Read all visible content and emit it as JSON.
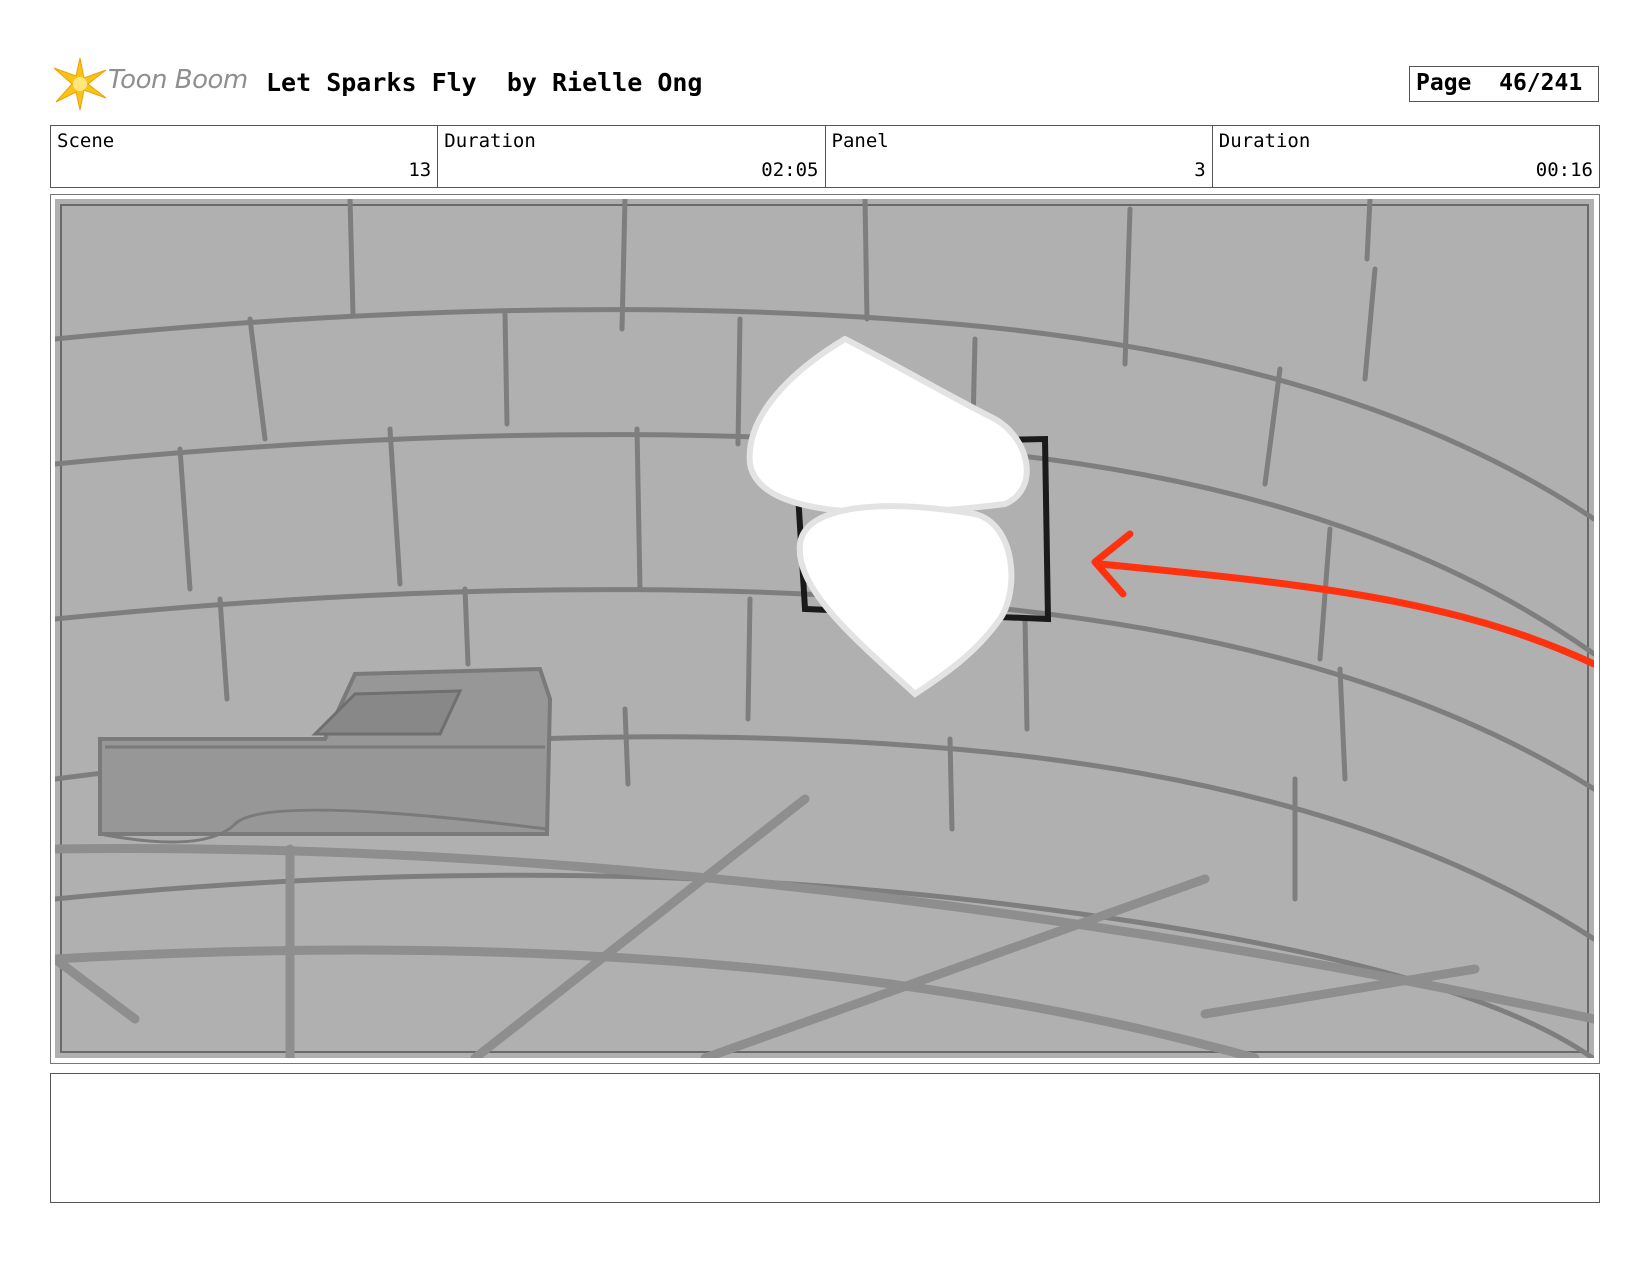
{
  "header": {
    "logo_text": "Toon Boom",
    "title": "Let Sparks Fly  by Rielle Ong",
    "page_label": "Page",
    "page_value": "46/241"
  },
  "info": [
    {
      "label": "Scene",
      "value": "13"
    },
    {
      "label": "Duration",
      "value": "02:05"
    },
    {
      "label": "Panel",
      "value": "3"
    },
    {
      "label": "Duration",
      "value": "00:16"
    }
  ],
  "notes": {
    "text": ""
  },
  "colors": {
    "wall": "#b0b0b0",
    "lines": "#7e7e7e",
    "arrow": "#ff3210",
    "logo_star": "#f7c417"
  }
}
